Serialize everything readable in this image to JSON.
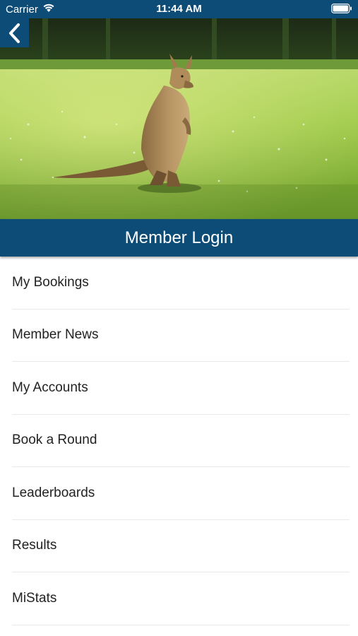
{
  "status_bar": {
    "carrier": "Carrier",
    "time": "11:44 AM",
    "icons": [
      "wifi-icon",
      "battery-icon"
    ]
  },
  "header": {
    "back_icon": "chevron-left-icon",
    "hero_image": "kangaroo standing on a green golf course",
    "title": "Member Login"
  },
  "menu": {
    "items": [
      {
        "label": "My Bookings"
      },
      {
        "label": "Member News"
      },
      {
        "label": "My Accounts"
      },
      {
        "label": "Book a Round"
      },
      {
        "label": "Leaderboards"
      },
      {
        "label": "Results"
      },
      {
        "label": "MiStats"
      }
    ]
  },
  "colors": {
    "brand": "#0e4c78",
    "text": "#222222",
    "divider": "#e9e9e9"
  }
}
